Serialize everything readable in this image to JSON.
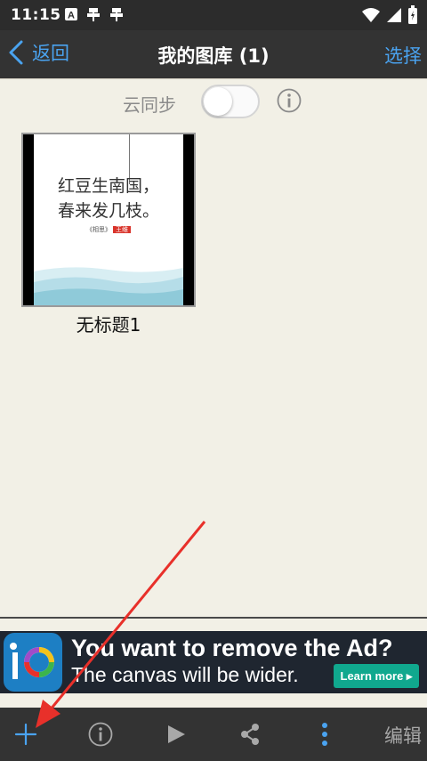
{
  "status_bar": {
    "time": "11:15",
    "icons": [
      "font-a-icon",
      "bug-icon",
      "bug-icon",
      "wifi-icon",
      "cellular-icon",
      "battery-icon"
    ]
  },
  "nav": {
    "back_label": "返回",
    "title": "我的图库 (1)",
    "select_label": "选择"
  },
  "sync": {
    "label": "云同步",
    "enabled": false
  },
  "gallery": {
    "items": [
      {
        "name": "无标题1",
        "poem_line1": "红豆生南国，",
        "poem_line2": "春来发几枝。",
        "source": "《相思》",
        "source_tag": "王维"
      }
    ]
  },
  "ad": {
    "headline": "You want to remove the Ad?",
    "subline": "The canvas will be wider.",
    "cta": "Learn more ▸"
  },
  "toolbar": {
    "edit_label": "编辑",
    "buttons": [
      "add-icon",
      "info-icon",
      "play-icon",
      "share-icon",
      "more-vertical-icon"
    ]
  },
  "colors": {
    "accent": "#4aa3f0",
    "bar_bg": "#333333",
    "canvas_bg": "#f2f0e6",
    "annotation_arrow": "#e8302a",
    "ad_cta": "#10a88e"
  }
}
